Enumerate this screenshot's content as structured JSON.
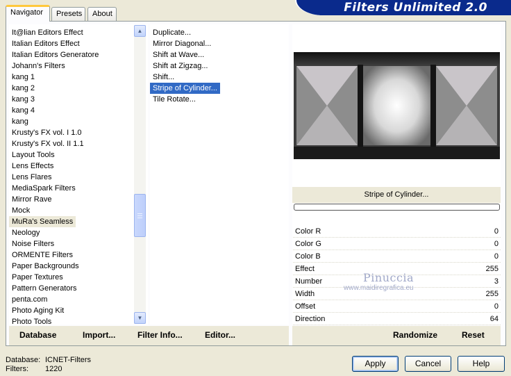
{
  "tabs": [
    "Navigator",
    "Presets",
    "About"
  ],
  "banner_title": "Filters Unlimited 2.0",
  "categories": [
    "It@lian Editors Effect",
    "Italian Editors Effect",
    "Italian Editors Generatore",
    "Johann's Filters",
    "kang 1",
    "kang 2",
    "kang 3",
    "kang 4",
    "kang",
    "Krusty's FX vol. I 1.0",
    "Krusty's FX vol. II 1.1",
    "Layout Tools",
    "Lens Effects",
    "Lens Flares",
    "MediaSpark Filters",
    "Mirror Rave",
    "Mock",
    "MuRa's Seamless",
    "Neology",
    "Noise Filters",
    "ORMENTE Filters",
    "Paper Backgrounds",
    "Paper Textures",
    "Pattern Generators",
    "penta.com",
    "Photo Aging Kit",
    "Photo Tools"
  ],
  "selected_category": "MuRa's Seamless",
  "filters": [
    "Duplicate...",
    "Mirror Diagonal...",
    "Shift at Wave...",
    "Shift at Zigzag...",
    "Shift...",
    "Stripe of Cylinder...",
    "Tile Rotate..."
  ],
  "selected_filter": "Stripe of Cylinder...",
  "left_buttons": {
    "database": "Database",
    "import": "Import...",
    "filter_info": "Filter Info...",
    "editor": "Editor..."
  },
  "preview": {
    "filter_name": "Stripe of Cylinder...",
    "watermark_name": "Pinuccia",
    "watermark_url": "www.maidiregrafica.eu",
    "progress": 0
  },
  "params": [
    {
      "name": "Color R",
      "value": "0"
    },
    {
      "name": "Color G",
      "value": "0"
    },
    {
      "name": "Color B",
      "value": "0"
    },
    {
      "name": "Effect",
      "value": "255"
    },
    {
      "name": "Number",
      "value": "3"
    },
    {
      "name": "Width",
      "value": "255"
    },
    {
      "name": "Offset",
      "value": "0"
    },
    {
      "name": "Direction",
      "value": "64"
    }
  ],
  "right_buttons": {
    "randomize": "Randomize",
    "reset": "Reset"
  },
  "status": {
    "database_label": "Database:",
    "database_value": "ICNET-Filters",
    "filters_label": "Filters:",
    "filters_value": "1220"
  },
  "dialog_buttons": {
    "apply": "Apply",
    "cancel": "Cancel",
    "help": "Help"
  },
  "colors": {
    "banner": "#0a2a8c",
    "selection": "#316ac5",
    "tab_highlight": "#ffc83c"
  }
}
